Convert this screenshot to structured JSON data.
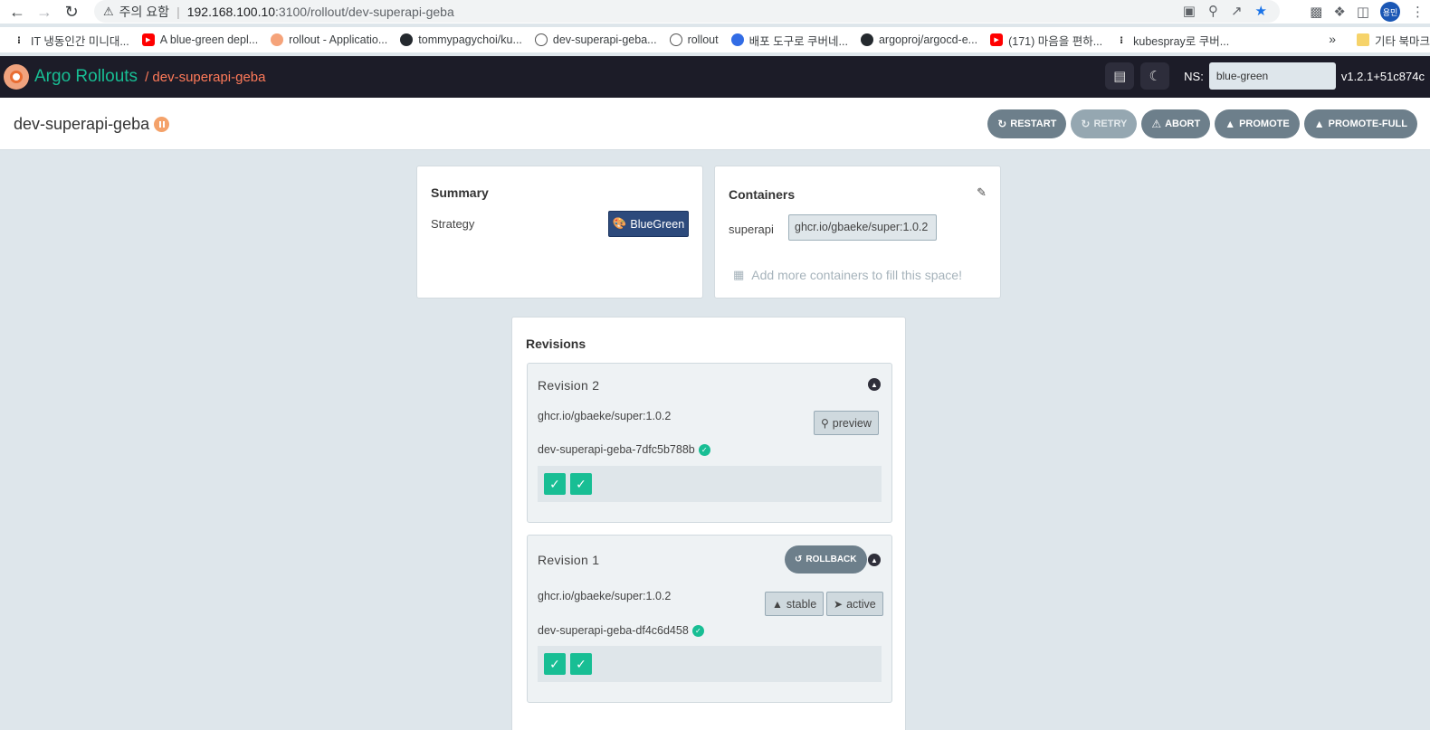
{
  "browser": {
    "security_warning": "주의 요함",
    "url_host": "192.168.100.10",
    "url_path": ":3100/rollout/dev-superapi-geba",
    "profile_label": "용민",
    "bookmarks": [
      {
        "icon": "dots",
        "label": "IT 냉동인간 미니대..."
      },
      {
        "icon": "yt",
        "label": "A blue-green depl..."
      },
      {
        "icon": "argo",
        "label": "rollout - Applicatio..."
      },
      {
        "icon": "gh",
        "label": "tommypagychoi/ku..."
      },
      {
        "icon": "globe",
        "label": "dev-superapi-geba..."
      },
      {
        "icon": "globe",
        "label": "rollout"
      },
      {
        "icon": "k8s",
        "label": "배포 도구로 쿠버네..."
      },
      {
        "icon": "gh",
        "label": "argoproj/argocd-e..."
      },
      {
        "icon": "yt",
        "label": "(171) 마음을 편하..."
      },
      {
        "icon": "dots",
        "label": "kubespray로 쿠버..."
      }
    ],
    "bookmarks_more": "»",
    "other_bookmarks": "기타 북마크"
  },
  "header": {
    "brand": "Argo Rollouts",
    "breadcrumb": "/ dev-superapi-geba",
    "ns_label": "NS:",
    "ns_value": "blue-green",
    "version": "v1.2.1+51c874c"
  },
  "title": {
    "rollout_name": "dev-superapi-geba",
    "status": "paused"
  },
  "actions": {
    "restart": "RESTART",
    "retry": "RETRY",
    "abort": "ABORT",
    "promote": "PROMOTE",
    "promote_full": "PROMOTE-FULL"
  },
  "summary": {
    "title": "Summary",
    "strategy_label": "Strategy",
    "strategy_value": "BlueGreen"
  },
  "containers": {
    "title": "Containers",
    "items": [
      {
        "name": "superapi",
        "image": "ghcr.io/gbaeke/super:1.0.2"
      }
    ],
    "add_more": "Add more containers to fill this space!"
  },
  "revisions": {
    "title": "Revisions",
    "items": [
      {
        "label": "Revision 2",
        "image": "ghcr.io/gbaeke/super:1.0.2",
        "replicaset": "dev-superapi-geba-7dfc5b788b",
        "tags": [
          "preview"
        ],
        "pods_ready": 2
      },
      {
        "label": "Revision 1",
        "image": "ghcr.io/gbaeke/super:1.0.2",
        "replicaset": "dev-superapi-geba-df4c6d458",
        "tags": [
          "stable",
          "active"
        ],
        "rollback_label": "ROLLBACK",
        "pods_ready": 2
      }
    ]
  },
  "colors": {
    "accent": "#18be94",
    "breadcrumb": "#ff7a59",
    "header_bg": "#1c1c28",
    "page_bg": "#dee6eb",
    "strategy_badge": "#2d4a7c"
  }
}
